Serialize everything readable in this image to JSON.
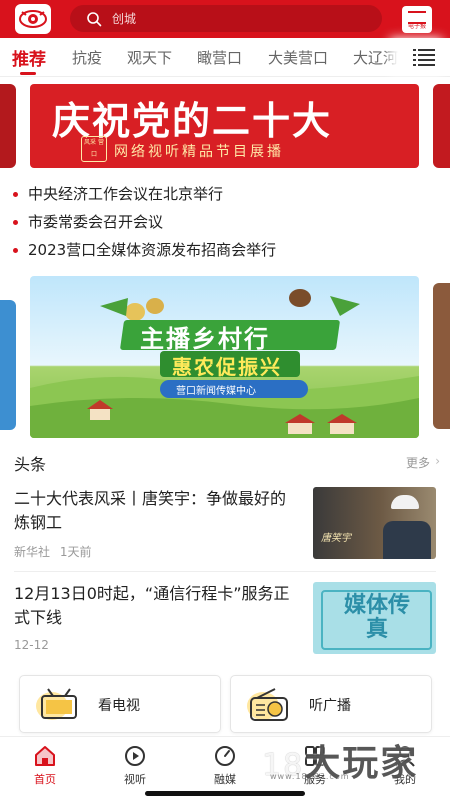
{
  "search": {
    "placeholder": "创城"
  },
  "header": {
    "epaper_label": "电子报"
  },
  "tabs": [
    {
      "label": "推荐",
      "active": true
    },
    {
      "label": "抗疫"
    },
    {
      "label": "观天下"
    },
    {
      "label": "瞰营口"
    },
    {
      "label": "大美营口"
    },
    {
      "label": "大辽河"
    }
  ],
  "banner1": {
    "headline": "庆祝党的二十大",
    "subtitle": "网络视听精品节目展播",
    "seal": "风采 营口"
  },
  "headlines": [
    "中央经济工作会议在北京举行",
    "市委常委会召开会议",
    "2023营口全媒体资源发布招商会举行"
  ],
  "banner2": {
    "title": "主播乡村行",
    "subtitle": "惠农促振兴",
    "org": "营口新闻传媒中心"
  },
  "section": {
    "title": "头条",
    "more": "更多"
  },
  "news": [
    {
      "title": "二十大代表风采丨唐笑宇：争做最好的炼钢工",
      "source": "新华社",
      "time": "1天前",
      "thumb_caption": "唐笑宇"
    },
    {
      "title": "12月13日0时起，“通信行程卡”服务正式下线",
      "source": "",
      "time": "12-12",
      "thumb_caption": "媒体传真"
    }
  ],
  "cards": [
    {
      "label": "看电视"
    },
    {
      "label": "听广播"
    }
  ],
  "bottom_nav": [
    {
      "label": "首页",
      "icon": "home-icon",
      "active": true
    },
    {
      "label": "视听",
      "icon": "play-icon"
    },
    {
      "label": "融媒",
      "icon": "compass-icon"
    },
    {
      "label": "服务",
      "icon": "grid-icon"
    },
    {
      "label": "我的",
      "icon": "user-icon"
    }
  ],
  "watermark": {
    "brand": "大玩家",
    "number": "18",
    "url": "www.18183.com"
  },
  "colors": {
    "brand_red": "#d8121c",
    "text": "#222222",
    "muted": "#999999"
  }
}
